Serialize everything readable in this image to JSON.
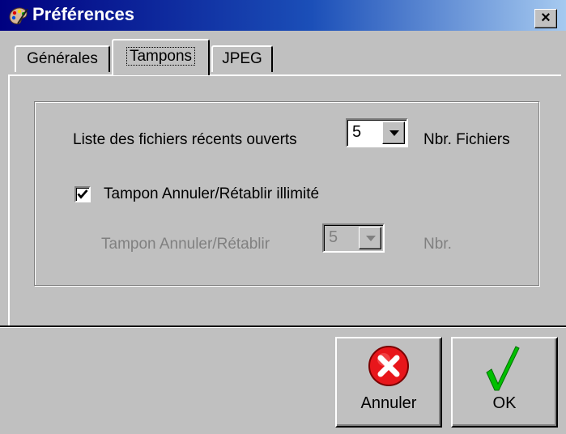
{
  "window": {
    "title": "Préférences",
    "close_label": "×"
  },
  "tabs": [
    {
      "label": "Générales",
      "active": false
    },
    {
      "label": "Tampons",
      "active": true
    },
    {
      "label": "JPEG",
      "active": false
    }
  ],
  "recent_files": {
    "label": "Liste des fichiers récents ouverts",
    "value": "5",
    "unit": "Nbr. Fichiers"
  },
  "unlimited_undo": {
    "label": "Tampon Annuler/Rétablir illimité",
    "checked": true
  },
  "undo_buffer": {
    "label": "Tampon Annuler/Rétablir",
    "value": "5",
    "unit": "Nbr.",
    "enabled": false
  },
  "buttons": {
    "cancel_label": "Annuler",
    "ok_label": "OK"
  },
  "colors": {
    "titlebar_start": "#000080",
    "titlebar_end": "#a6caf0",
    "face": "#c0c0c0",
    "cancel_icon": "#e8161b",
    "ok_icon": "#00c000"
  },
  "icons": {
    "app": "palette-icon",
    "cancel": "cancel-x-icon",
    "ok": "checkmark-icon",
    "dropdown": "chevron-down-icon"
  }
}
